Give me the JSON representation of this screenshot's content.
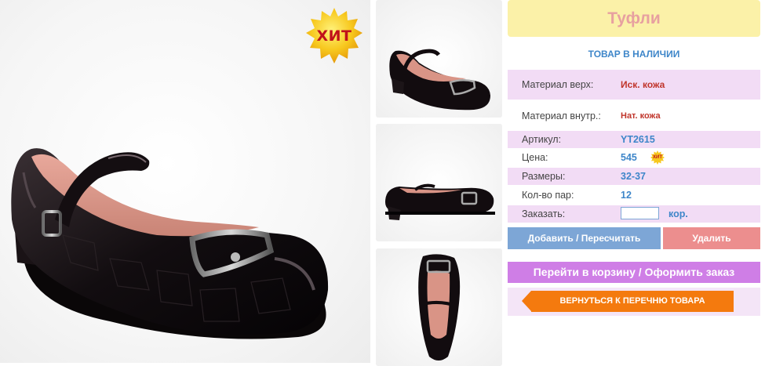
{
  "product": {
    "title": "Туфли",
    "stock_status": "ТОВАР В НАЛИЧИИ",
    "badge": "ХИТ",
    "price_badge": "ХИТ"
  },
  "details": {
    "material_top_label": "Материал верх:",
    "material_top_value": "Иск. кожа",
    "material_inner_label": "Материал внутр.:",
    "material_inner_value": "Нат. кожа",
    "article_label": "Артикул:",
    "article_value": "YT2615",
    "price_label": "Цена:",
    "price_value": "545",
    "sizes_label": "Размеры:",
    "sizes_value": "32-37",
    "pairs_label": "Кол-во пар:",
    "pairs_value": "12",
    "order_label": "Заказать:",
    "order_quantity": "",
    "order_unit": "кор."
  },
  "actions": {
    "add_label": "Добавить / Пересчитать",
    "delete_label": "Удалить",
    "cart_label": "Перейти в корзину / Оформить заказ",
    "back_label": "ВЕРНУТЬСЯ К ПЕРЕЧНЮ ТОВАРА"
  },
  "colors": {
    "title_bg": "#fbf1a8",
    "title_text": "#e7a0a0",
    "accent_blue": "#3e86c9",
    "row_pink": "#f2dcf5",
    "add_button": "#7da6d6",
    "delete_button": "#ec8e8e",
    "cart_button": "#cf7ee6",
    "back_button": "#f47a0e"
  },
  "icons": {
    "badge": "starburst-badge-icon",
    "back": "arrow-left-icon"
  }
}
